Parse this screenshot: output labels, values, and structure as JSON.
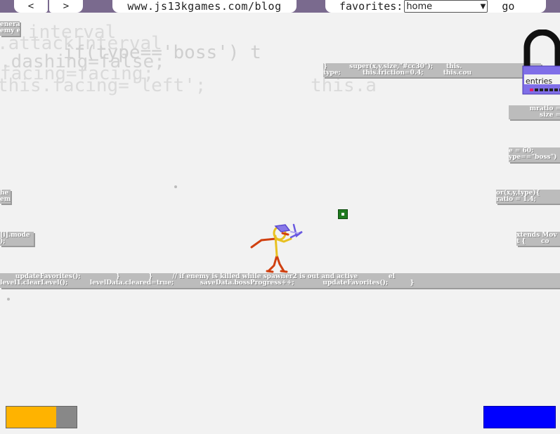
{
  "nav": {
    "back_label": "<",
    "forward_label": ">",
    "url": "www.js13kgames.com/blog",
    "favorites_label": "favorites:",
    "favorites_selected": "home",
    "go_label": "go"
  },
  "ghost_code": {
    "line1": "interval",
    "line2": ".attackInterval",
    "line3": ".dashing=false;",
    "line4": "if(type=='boss') t",
    "line5": "facing=facing;",
    "line6": "this.facing='left';",
    "line7": "this.a"
  },
  "platforms": {
    "p1": {
      "line1": "enera",
      "line2": "emy e"
    },
    "p2": {
      "line1": "}          super(x,y,size,\"#cc30\");      this.",
      "line2": "type;          this.friction=0.4;         this.cou"
    },
    "p3": {
      "line1": "mratio =",
      "line2": "size ="
    },
    "p4": {
      "line1": "e = 60;",
      "line2": "ype==\"boss\")"
    },
    "p5": {
      "line1": "he",
      "line2": "emi"
    },
    "p6": {
      "line1": "or(x,y,type){",
      "line2": "ratio = 1.4;"
    },
    "p7": {
      "line1": "[i].mode",
      "line2": ");"
    },
    "p8": {
      "line1": "xtends Mov",
      "line2": "t {       co"
    },
    "p9": {
      "line1": "       updateFavorites();                }             }         // if enemy is killed while spawner2 is out and active              el",
      "line2": "level1.clearLevel();          levelData.cleared=true;            saveData.bossProgress++;             updateFavorites();          }"
    }
  },
  "lock": {
    "label": "entries"
  },
  "status": {
    "health_fraction": 0.71,
    "energy_fraction": 1.0
  },
  "colors": {
    "topbar": "#7a6a8e",
    "health": "#ffb300",
    "energy": "#0000ff",
    "collectible": "#1e7a1e"
  }
}
